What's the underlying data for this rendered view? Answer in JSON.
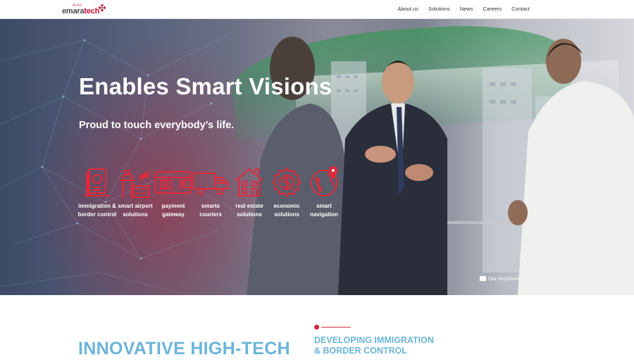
{
  "logo": {
    "text_main": "emara",
    "text_accent": "tech",
    "text_arabic": "إمارتك"
  },
  "nav": [
    "About us",
    "Solutions",
    "News",
    "Careers",
    "Contact"
  ],
  "hero": {
    "title": "Enables Smart Visions",
    "subtitle": "Proud to touch everybody’s life.",
    "brochure_label": "Our Brochure"
  },
  "services": [
    {
      "line1": "immigration &",
      "line2": "border control",
      "icon": "passport-icon"
    },
    {
      "line1": "smart airport",
      "line2": "solutions",
      "icon": "airport-icon"
    },
    {
      "line1": "payment",
      "line2": "gateway",
      "icon": "wallet-icon"
    },
    {
      "line1": "smarts",
      "line2": "couriers",
      "icon": "truck-icon"
    },
    {
      "line1": "real estate",
      "line2": "solutions",
      "icon": "building-icon"
    },
    {
      "line1": "economic",
      "line2": "solutions",
      "icon": "dollar-gear-icon"
    },
    {
      "line1": "smart",
      "line2": "navigation",
      "icon": "globe-pin-icon"
    }
  ],
  "section": {
    "heading": "INNOVATIVE HIGH-TECH",
    "sub_line1": "DEVELOPING IMMIGRATION",
    "sub_line2": "& BORDER CONTROL"
  },
  "colors": {
    "accent_red": "#d0293b",
    "accent_blue": "#6cb4d8",
    "icon_red": "#e02a3c"
  }
}
